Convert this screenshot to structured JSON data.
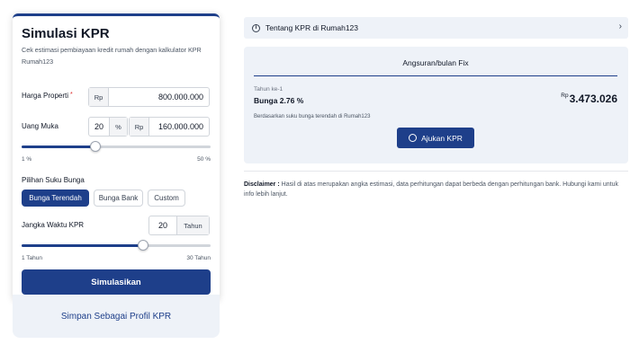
{
  "calculator": {
    "title": "Simulasi KPR",
    "subtitle": "Cek estimasi pembiayaan kredit rumah dengan kalkulator KPR Rumah123",
    "harga": {
      "label": "Harga Properti",
      "required_mark": "*",
      "prefix": "Rp",
      "value": "800.000.000"
    },
    "uang_muka": {
      "label": "Uang Muka",
      "percent_value": "20",
      "percent_suffix": "%",
      "prefix": "Rp",
      "value": "160.000.000"
    },
    "dp_slider": {
      "level_percent": 20,
      "min_label": "1 %",
      "max_label": "50 %"
    },
    "suku_bunga": {
      "label": "Pilihan Suku Bunga",
      "options": [
        "Bunga Terendah",
        "Bunga Bank",
        "Custom"
      ],
      "selected": "Bunga Terendah"
    },
    "jangka": {
      "label": "Jangka Waktu KPR",
      "value": "20",
      "suffix": "Tahun"
    },
    "tenor_slider": {
      "level_years": 20,
      "min_label": "1 Tahun",
      "max_label": "30 Tahun"
    },
    "submit_label": "Simulasikan",
    "save_profile_label": "Simpan Sebagai Profil KPR"
  },
  "about": {
    "label": "Tentang KPR di Rumah123",
    "info_icon": "i",
    "chevron": "›"
  },
  "result": {
    "header": "Angsuran/bulan Fix",
    "year_label": "Tahun ke-1",
    "interest": "Bunga 2.76 %",
    "currency": "Rp",
    "amount": "3.473.026",
    "note": "Berdasarkan suku bunga terendah di Rumah123",
    "apply_label": "Ajukan KPR"
  },
  "disclaimer": {
    "title": "Disclaimer :",
    "text": "Hasil di atas merupakan angka estimasi, data perhitungan dapat berbeda dengan perhitungan bank. Hubungi kami untuk info lebih lanjut."
  },
  "colors": {
    "primary": "#1e3f8a",
    "panel_bg": "#eef2f8"
  }
}
